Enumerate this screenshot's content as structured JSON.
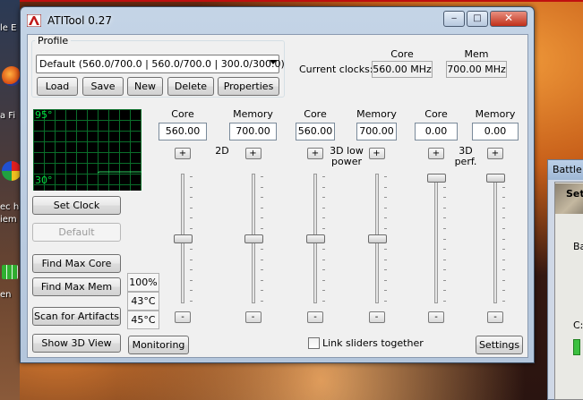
{
  "desktop": {
    "labels": [
      "le E",
      "a Fi",
      "ec h",
      "iem",
      "en"
    ],
    "bg_window_title": "Battle",
    "bg_window_letters": [
      "Set",
      "Ba",
      "C:"
    ]
  },
  "window": {
    "title": "ATITool 0.27",
    "minimize_label": "‒",
    "maximize_label": "□",
    "close_label": "✕"
  },
  "profile": {
    "group_label": "Profile",
    "selected": "Default (560.0/700.0 | 560.0/700.0 | 300.0/300.0)",
    "buttons": {
      "load": "Load",
      "save": "Save",
      "new": "New",
      "delete": "Delete",
      "properties": "Properties"
    }
  },
  "current_clocks": {
    "label": "Current clocks:",
    "core_header": "Core",
    "mem_header": "Mem",
    "core_value": "560.00 MHz",
    "mem_value": "700.00 MHz"
  },
  "graph": {
    "top_label": "95°",
    "bottom_label": "30°"
  },
  "left_buttons": {
    "set_clock": "Set Clock",
    "default": "Default",
    "find_max_core": "Find Max Core",
    "find_max_mem": "Find Max Mem",
    "scan_artifacts": "Scan for Artifacts",
    "show_3d_view": "Show 3D View",
    "monitoring": "Monitoring"
  },
  "status": {
    "fan": "100%",
    "temp1": "43°C",
    "temp2": "45°C"
  },
  "clock_groups": [
    {
      "mode_label": "2D",
      "core_header": "Core",
      "mem_header": "Memory",
      "core_value": "560.00",
      "mem_value": "700.00",
      "core_level": 0.5,
      "mem_level": 0.5
    },
    {
      "mode_label": "3D low power",
      "core_header": "Core",
      "mem_header": "Memory",
      "core_value": "560.00",
      "mem_value": "700.00",
      "core_level": 0.5,
      "mem_level": 0.5
    },
    {
      "mode_label": "3D perf.",
      "core_header": "Core",
      "mem_header": "Memory",
      "core_value": "0.00",
      "mem_value": "0.00",
      "core_level": 1.0,
      "mem_level": 1.0
    }
  ],
  "plus_label": "+",
  "minus_label": "-",
  "link_sliders": {
    "label": "Link sliders together",
    "checked": false
  },
  "settings_button": "Settings"
}
